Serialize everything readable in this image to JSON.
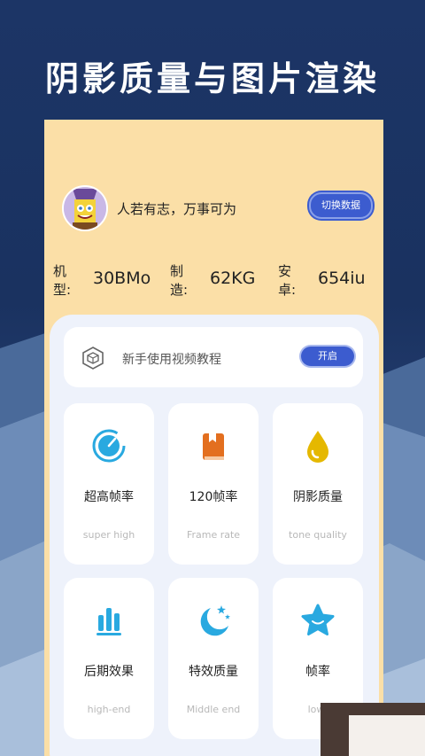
{
  "banner": {
    "title": "阴影质量与图片渲染"
  },
  "profile": {
    "slogan": "人若有志，万事可为",
    "switch_label": "切换数据"
  },
  "stats": [
    {
      "label": "机型:",
      "value": "30BMo"
    },
    {
      "label": "制造:",
      "value": "62KG"
    },
    {
      "label": "安卓:",
      "value": "654iu"
    }
  ],
  "tutorial": {
    "text": "新手使用视频教程",
    "button": "开启"
  },
  "cards": [
    {
      "title": "超高帧率",
      "subtitle": "super high",
      "icon": "gauge-icon"
    },
    {
      "title": "120帧率",
      "subtitle": "Frame rate",
      "icon": "book-icon"
    },
    {
      "title": "阴影质量",
      "subtitle": "tone quality",
      "icon": "drop-icon"
    },
    {
      "title": "后期效果",
      "subtitle": "high-end",
      "icon": "bars-icon"
    },
    {
      "title": "特效质量",
      "subtitle": "Middle end",
      "icon": "moon-icon"
    },
    {
      "title": "帧率",
      "subtitle": "low-",
      "icon": "star-icon"
    }
  ],
  "colors": {
    "accent": "#3c5ccf",
    "header_bg": "#fbdfa7",
    "page_bg": "#1c3566",
    "icon_blue": "#29a9e0",
    "icon_orange": "#e36f1f",
    "icon_yellow": "#e5b800"
  }
}
